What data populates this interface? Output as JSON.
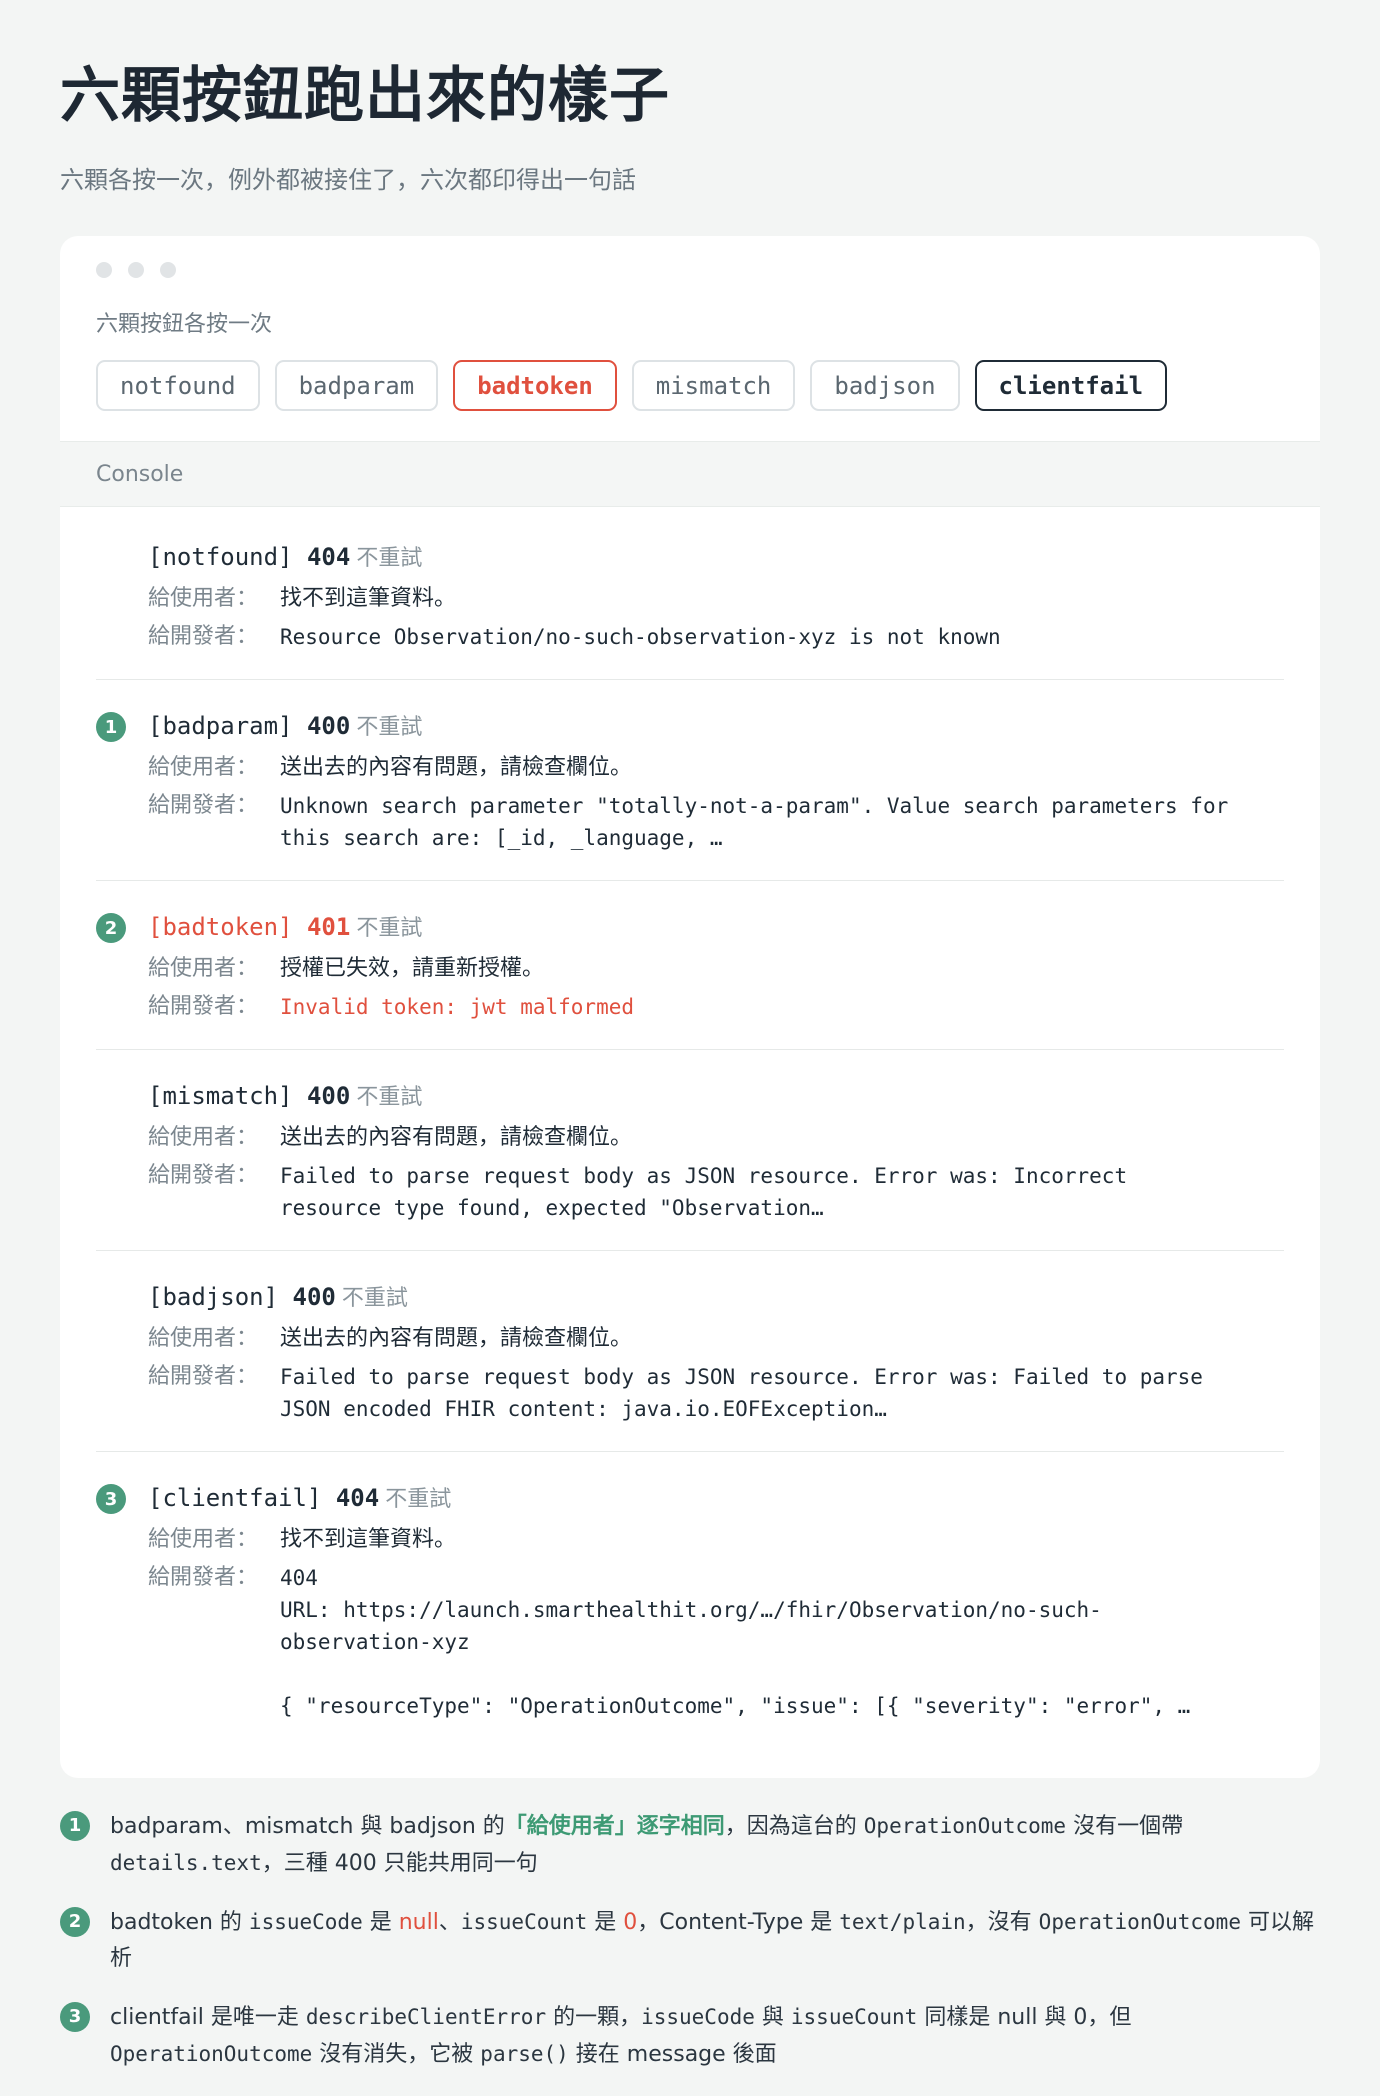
{
  "header": {
    "title": "六顆按鈕跑出來的樣子",
    "subtitle": "六顆各按一次，例外都被接住了，六次都印得出一句話"
  },
  "buttons_label": "六顆按鈕各按一次",
  "buttons": [
    "notfound",
    "badparam",
    "badtoken",
    "mismatch",
    "badjson",
    "clientfail"
  ],
  "console_label": "Console",
  "field_labels": {
    "user": "給使用者：",
    "dev": "給開發者："
  },
  "no_retry": "不重試",
  "entries": [
    {
      "badge": "",
      "tag": "[notfound]",
      "code": "404",
      "user": "找不到這筆資料。",
      "dev": "Resource Observation/no-such-observation-xyz is not known"
    },
    {
      "badge": "1",
      "tag": "[badparam]",
      "code": "400",
      "user": "送出去的內容有問題，請檢查欄位。",
      "dev": "Unknown search parameter \"totally-not-a-param\". Value search parameters for\nthis search are: [_id, _language, …"
    },
    {
      "badge": "2",
      "tag": "[badtoken]",
      "code": "401",
      "user": "授權已失效，請重新授權。",
      "dev": "Invalid token: jwt malformed"
    },
    {
      "badge": "",
      "tag": "[mismatch]",
      "code": "400",
      "user": "送出去的內容有問題，請檢查欄位。",
      "dev": "Failed to parse request body as JSON resource. Error was: Incorrect\nresource type found, expected \"Observation…"
    },
    {
      "badge": "",
      "tag": "[badjson]",
      "code": "400",
      "user": "送出去的內容有問題，請檢查欄位。",
      "dev": "Failed to parse request body as JSON resource. Error was: Failed to parse\nJSON encoded FHIR content: java.io.EOFException…"
    },
    {
      "badge": "3",
      "tag": "[clientfail]",
      "code": "404",
      "user": "找不到這筆資料。",
      "dev": "404\nURL: https://launch.smarthealthit.org/…/fhir/Observation/no-such-\nobservation-xyz\n\n{ \"resourceType\": \"OperationOutcome\", \"issue\": [{ \"severity\": \"error\", …"
    }
  ],
  "notes": [
    {
      "badge": "1",
      "parts": [
        "badparam、mismatch 與 badjson 的",
        "「給使用者」逐字相同",
        "，因為這台的 ",
        "OperationOutcome",
        " 沒有一個帶",
        "details.text",
        "，三種 400 只能共用同一句"
      ]
    },
    {
      "badge": "2",
      "parts": [
        "badtoken 的 ",
        "issueCode",
        " 是 ",
        "null",
        "、",
        "issueCount",
        " 是 ",
        "0",
        "，Content-Type 是 ",
        "text/plain",
        "，沒有 ",
        "OperationOutcome",
        " 可以解析"
      ]
    },
    {
      "badge": "3",
      "parts": [
        "clientfail 是唯一走 ",
        "describeClientError",
        " 的一顆，",
        "issueCode",
        " 與 ",
        "issueCount",
        " 同樣是 null 與 0，但",
        "OperationOutcome",
        " 沒有消失，它被 ",
        "parse()",
        " 接在 message 後面"
      ]
    }
  ]
}
